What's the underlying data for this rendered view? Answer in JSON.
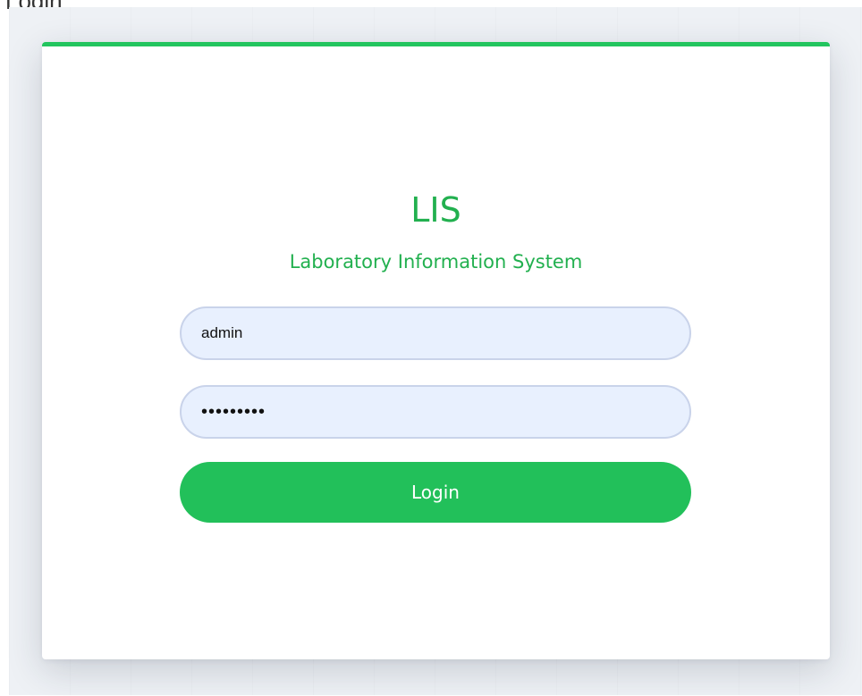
{
  "page": {
    "cropped_title": "Login"
  },
  "login_card": {
    "title": "LIS",
    "subtitle": "Laboratory Information System",
    "username": {
      "value": "admin"
    },
    "password": {
      "value": "•••••••••"
    },
    "login_button_label": "Login"
  },
  "colors": {
    "accent": "#22c55e",
    "button": "#22c05a",
    "input_bg": "#e8f0fe",
    "input_border": "#c9d3ea",
    "title_text": "#22b04f"
  }
}
